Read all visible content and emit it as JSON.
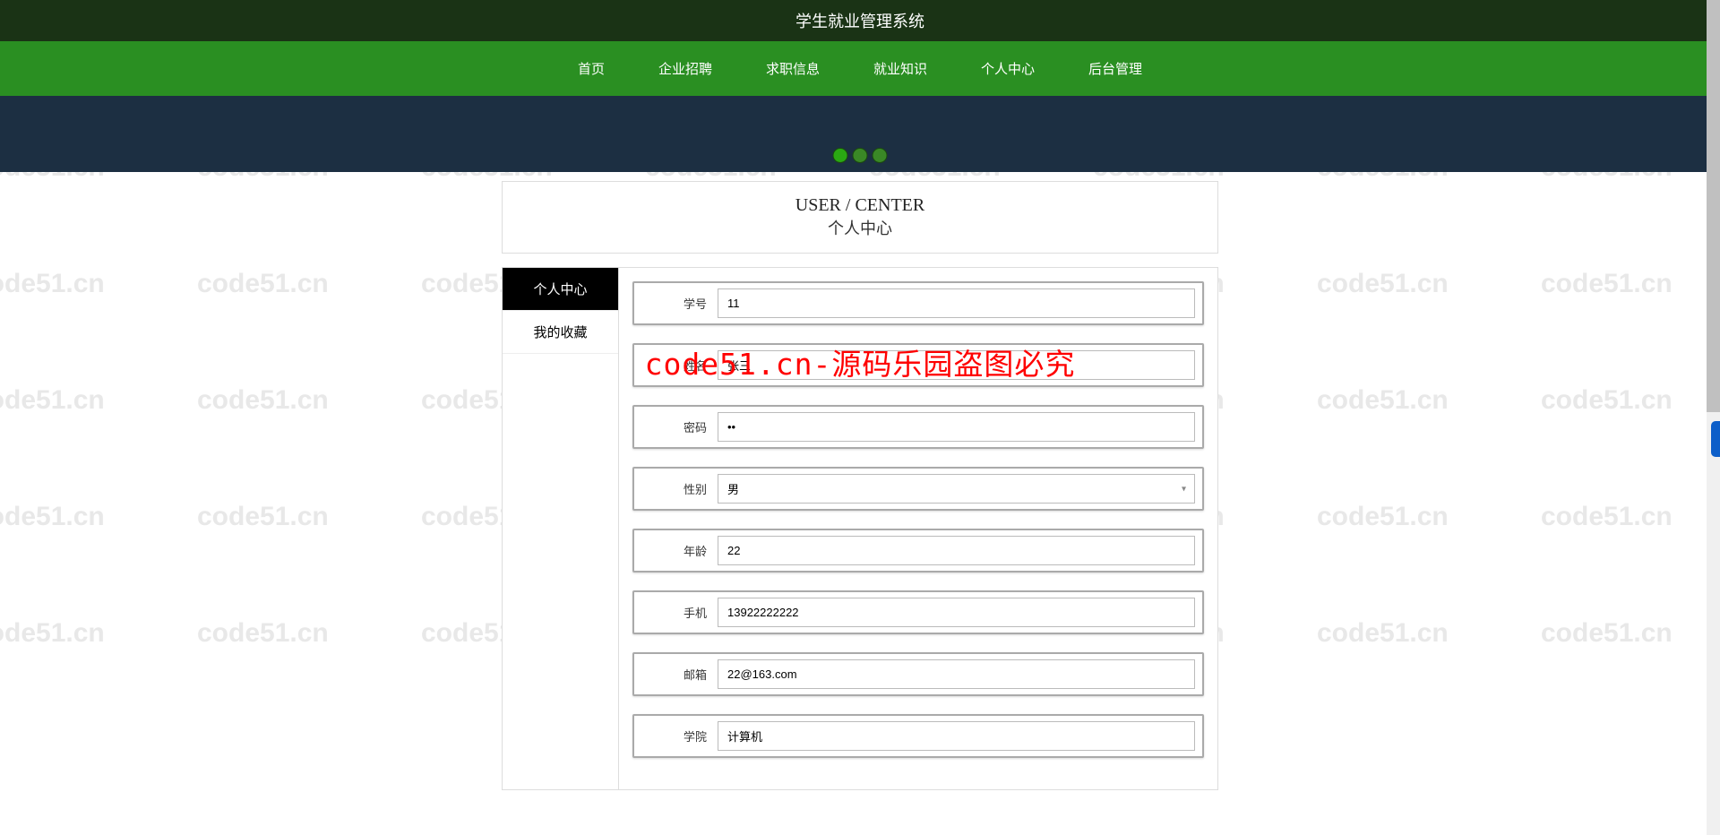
{
  "header": {
    "title": "学生就业管理系统"
  },
  "nav": {
    "items": [
      "首页",
      "企业招聘",
      "求职信息",
      "就业知识",
      "个人中心",
      "后台管理"
    ]
  },
  "section": {
    "title_en": "USER / CENTER",
    "title_cn": "个人中心"
  },
  "sidebar": {
    "items": [
      {
        "label": "个人中心",
        "active": true
      },
      {
        "label": "我的收藏",
        "active": false
      }
    ]
  },
  "form": {
    "fields": [
      {
        "label": "学号",
        "value": "11",
        "type": "text"
      },
      {
        "label": "姓名",
        "value": "张三",
        "type": "text"
      },
      {
        "label": "密码",
        "value": "••",
        "type": "password"
      },
      {
        "label": "性别",
        "value": "男",
        "type": "select"
      },
      {
        "label": "年龄",
        "value": "22",
        "type": "text"
      },
      {
        "label": "手机",
        "value": "13922222222",
        "type": "text"
      },
      {
        "label": "邮箱",
        "value": "22@163.com",
        "type": "text"
      },
      {
        "label": "学院",
        "value": "计算机",
        "type": "text"
      }
    ]
  },
  "watermark": {
    "text": "code51.cn"
  },
  "overlay": {
    "text": "code51.cn-源码乐园盗图必究"
  }
}
